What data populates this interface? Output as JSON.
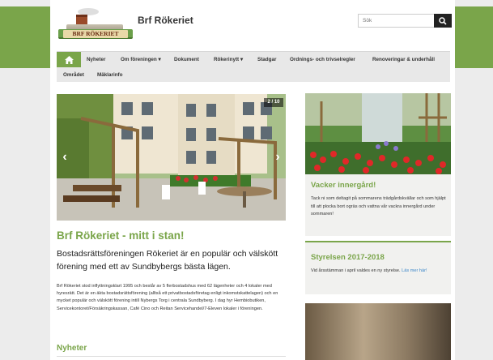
{
  "header": {
    "logo_text": "BRF RÖKERIET",
    "site_title": "Brf Rökeriet",
    "search": {
      "placeholder": "Sök",
      "button_icon": "search-icon"
    }
  },
  "nav": {
    "home_icon": "home-icon",
    "items": [
      {
        "label": "Nyheter"
      },
      {
        "label": "Om föreningen ▾"
      },
      {
        "label": "Dokument"
      },
      {
        "label": "Rökerinytt ▾"
      },
      {
        "label": "Stadgar"
      },
      {
        "label": "Ordnings- och trivselregler"
      },
      {
        "label": "Renoveringar & underhåll"
      },
      {
        "label": "Området"
      },
      {
        "label": "Mäklarinfo"
      }
    ]
  },
  "slider": {
    "counter": "2 / 10",
    "prev_icon": "chevron-left-icon",
    "next_icon": "chevron-right-icon"
  },
  "main": {
    "headline": "Brf Rökeriet - mitt i stan!",
    "intro": "Bostadsrättsföreningen Rökeriet är en populär och välskött förening med ett av Sundbybergs bästa lägen.",
    "body": "Brf Rökeriet stod inflyttningsklart 1995 och består av 5 flerbostadshus med 62 lägenheter och 4 lokaler med hyresrätt. Det är en äkta bostadsrättsförening (alltså ett privatbostadsföretag enligt inkomstskattelagen) och en mycket populär och välskött förening intill Nybergs Torg i centrala Sundbyberg. I dag hyr Hembiobutiken, Servicekontoret/Försäkringskassan, Café Cino och Reitan Servicehandel/7-Eleven lokaler i föreningen.",
    "news_heading": "Nyheter"
  },
  "sidebar": {
    "card1": {
      "title": "Vacker innergård!",
      "text": "Tack ni som deltagit på sommarens trädgårdskvällar och som hjälpt till att plocka bort ogräs och vattna vår vackra innergård under sommaren!"
    },
    "card2": {
      "title": "Styrelsen 2017-2018",
      "text": "Vid årsstämman i april valdes en ny styrelse.",
      "link": "Läs mer här!"
    }
  },
  "colors": {
    "accent": "#7aa54a",
    "link": "#3a86c8",
    "background": "#ececec"
  }
}
